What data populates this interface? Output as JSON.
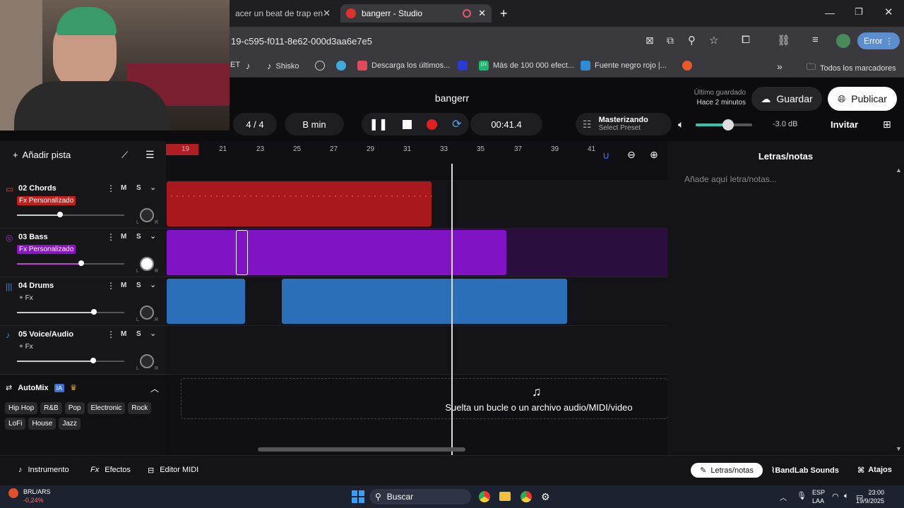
{
  "browser": {
    "tabs": [
      {
        "label": "acer un beat de trap en"
      },
      {
        "label": "bangerr - Studio"
      }
    ],
    "url": "19-c595-f011-8e62-000d3aa6e7e5",
    "profile_status": "Error",
    "bookmarks": [
      "ET",
      "Shisko",
      "",
      "",
      "Descarga los últimos...",
      "",
      "Más de 100 000 efect...",
      "Fuente negro rojo |..."
    ],
    "all_bookmarks": "Todos los marcadores"
  },
  "header": {
    "project_title": "bangerr",
    "last_saved_label": "Último guardado",
    "last_saved_time": "Hace 2 minutos",
    "save_label": "Guardar",
    "publish_label": "Publicar",
    "time_signature": "4 / 4",
    "key": "B min",
    "timecode": "00:41.4",
    "mastering_label": "Masterizando",
    "select_preset": "Select Preset",
    "volume_db": "-3.0 dB",
    "invite_label": "Invitar"
  },
  "toolbar": {
    "add_track": "Añadir pista"
  },
  "ruler": [
    "19",
    "21",
    "23",
    "25",
    "27",
    "29",
    "31",
    "33",
    "35",
    "37",
    "39",
    "41"
  ],
  "tracks": [
    {
      "name": "02 Chords",
      "fx": "Fx Personalizado",
      "color": "#c0201e"
    },
    {
      "name": "03 Bass",
      "fx": "Fx Personalizado",
      "color": "#8a15c7"
    },
    {
      "name": "04 Drums",
      "fx": "+ Fx",
      "color": "#2f76c2"
    },
    {
      "name": "05 Voice/Audio",
      "fx": "+ Fx",
      "color": "#2f76c2"
    }
  ],
  "mute_label": "M",
  "solo_label": "S",
  "automix": {
    "label": "AutoMix",
    "badge": "IA",
    "genres": [
      "Hip Hop",
      "R&B",
      "Pop",
      "Electronic",
      "Rock",
      "LoFi",
      "House",
      "Jazz"
    ]
  },
  "drop_zone": "Suelta un bucle o un archivo audio/MIDI/video",
  "notes": {
    "title": "Letras/notas",
    "placeholder": "Añade aquí letra/notas..."
  },
  "bottom": {
    "instrument": "Instrumento",
    "effects": "Efectos",
    "midi": "Editor MIDI",
    "notes_tab": "Letras/notas",
    "sounds": "BandLab Sounds",
    "shortcuts": "Atajos"
  },
  "taskbar": {
    "ticker": "BRL/ARS",
    "change": "-0,24%",
    "search": "Buscar",
    "lang1": "ESP",
    "lang2": "LAA",
    "time": "23:00",
    "date": "19/9/2025"
  }
}
